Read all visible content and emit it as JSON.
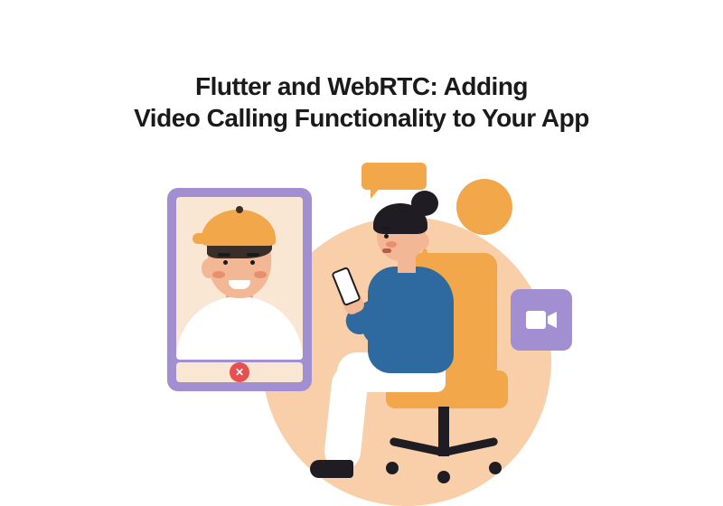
{
  "title_line1": "Flutter and WebRTC: Adding",
  "title_line2": "Video Calling Functionality to Your App",
  "icons": {
    "chat": "chat-bubble-icon",
    "video": "video-camera-icon",
    "end_call": "end-call-icon"
  },
  "colors": {
    "accent_purple": "#a18fd1",
    "accent_orange": "#f2a74b",
    "accent_peach": "#f8cfa8",
    "accent_blue": "#2e6aa0",
    "accent_red": "#e94f4f",
    "text": "#1a1a1a"
  },
  "end_call_glyph": "✕"
}
